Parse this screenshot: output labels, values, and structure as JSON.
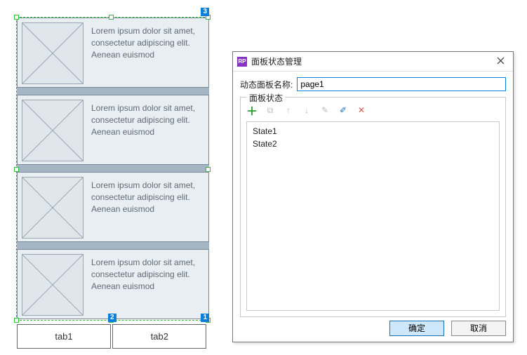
{
  "canvas": {
    "rows": [
      {
        "text": "Lorem ipsum dolor sit amet, consectetur adipiscing elit. Aenean euismod"
      },
      {
        "text": "Lorem ipsum dolor sit amet, consectetur adipiscing elit. Aenean euismod"
      },
      {
        "text": "Lorem ipsum dolor sit amet, consectetur adipiscing elit. Aenean euismod"
      },
      {
        "text": "Lorem ipsum dolor sit amet, consectetur adipiscing elit. Aenean euismod"
      }
    ],
    "badges": {
      "top_right": "3",
      "bottom_left": "2",
      "bottom_right": "1"
    }
  },
  "tabs": {
    "tab1": "tab1",
    "tab2": "tab2"
  },
  "dialog": {
    "app_icon_text": "RP",
    "title": "面板状态管理",
    "name_label": "动态面板名称:",
    "name_value": "page1",
    "states_label": "面板状态",
    "states": [
      "State1",
      "State2"
    ],
    "ok_label": "确定",
    "cancel_label": "取消"
  },
  "icons": {
    "add": "＋",
    "duplicate": "⧉",
    "up": "↑",
    "down": "↓",
    "rename": "✎",
    "edit": "✐",
    "delete": "✕"
  },
  "colors": {
    "selection_green": "#2dbd3a",
    "badge_blue": "#0a7fd9",
    "rp_purple": "#8a2fc7"
  }
}
